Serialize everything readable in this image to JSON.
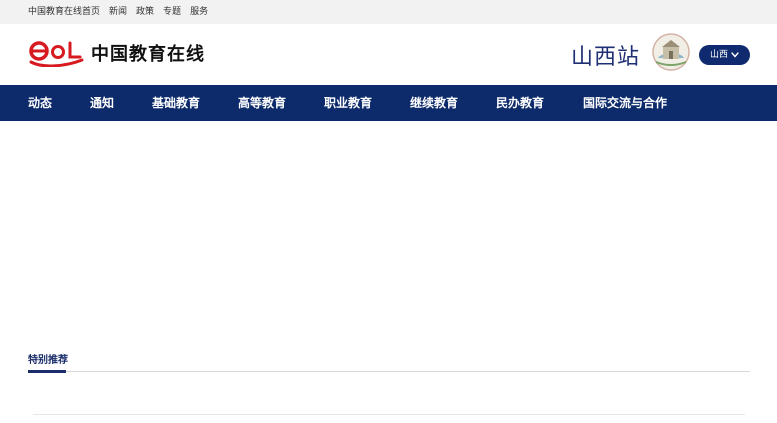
{
  "topbar": {
    "links": [
      "中国教育在线首页",
      "新闻",
      "政策",
      "专题",
      "服务"
    ]
  },
  "header": {
    "logo_text": "中国教育在线",
    "station": "山西站",
    "region_button": "山西"
  },
  "nav": {
    "items": [
      "动态",
      "通知",
      "基础教育",
      "高等教育",
      "职业教育",
      "继续教育",
      "民办教育",
      "国际交流与合作"
    ]
  },
  "section": {
    "title": "特别推荐"
  },
  "colors": {
    "nav_bg": "#0d2a6b",
    "brand_red": "#d71920",
    "accent_blue": "#1b2e6b"
  }
}
